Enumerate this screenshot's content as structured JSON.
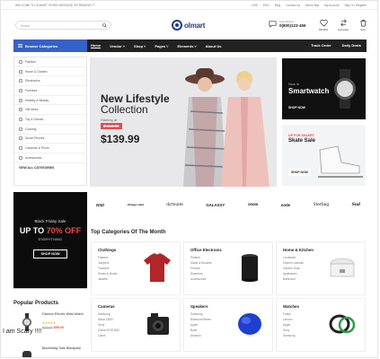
{
  "topbar": {
    "welcome": "WELCOME TO OLMART STORE MESSAGE OR REMOVE IT",
    "currency": "USD",
    "language": "ENG",
    "links": [
      "Blog",
      "Contact Us",
      "Need Help",
      "My Account",
      "Sign In / Register"
    ]
  },
  "header": {
    "search_placeholder": "Search...",
    "logo": "olmart",
    "call_label": "Live Chat or :",
    "phone": "0(800)123-456",
    "wishlist": "Wishlist",
    "compare": "Compare",
    "cart": "Cart"
  },
  "nav": {
    "browse": "Browse Categories",
    "items": [
      {
        "label": "Home",
        "active": true
      },
      {
        "label": "Vendor"
      },
      {
        "label": "Shop"
      },
      {
        "label": "Pages"
      },
      {
        "label": "Elements"
      },
      {
        "label": "About Us"
      }
    ],
    "right": [
      "Track Order",
      "Daily Deals"
    ]
  },
  "sidebar": {
    "items": [
      "Fashion",
      "Home & Garden",
      "Electronics",
      "Furniture",
      "Healthy & Beauty",
      "Gift Ideas",
      "Toy & Games",
      "Cooking",
      "Smart Phones",
      "Cameras & Photo",
      "Accessories",
      "VIEW ALL CATEGORIES"
    ]
  },
  "hero": {
    "title_line1": "New Lifestyle",
    "title_line2": "Collection",
    "starting": "Starting at",
    "old_price": "$ 150.00",
    "price": "$139.99"
  },
  "banner1": {
    "kicker": "Now in",
    "title": "Smartwatch",
    "cta": "SHOP NOW"
  },
  "banner2": {
    "kicker": "UP FOR SKI/ART",
    "title_line1": "Skate Sale",
    "title_line2": "",
    "cta": "SHOP NOW"
  },
  "brands": [
    "NSD",
    "Vintage Label",
    "dirtsuite",
    "GALAXXY",
    "ORIGIN",
    "node",
    "Sterling",
    "Sud"
  ],
  "promo": {
    "line1": "Black Friday Sale",
    "line2_a": "UP TO",
    "line2_b": "70% OFF",
    "line3": "EVERYTHING",
    "cta": "SHOP NOW"
  },
  "top_categories": {
    "title": "Top Categories Of The Month",
    "cards": [
      {
        "name": "Clothings",
        "subs": [
          "Fashion",
          "Jumpers",
          "Trousers",
          "Shoes & Boots",
          "Jackets"
        ]
      },
      {
        "name": "Office Electronic",
        "subs": [
          "Printers",
          "Stand & Buckets",
          "Phones",
          "Scanners",
          "Accessories"
        ]
      },
      {
        "name": "Home & Kitchen",
        "subs": [
          "Cookware",
          "Kitchen Utensils",
          "Garden Tools",
          "Appliances",
          "Bathroom"
        ]
      },
      {
        "name": "Cameras",
        "subs": [
          "Samsung",
          "Nikon D850",
          "Sony",
          "Canon EOS 80D",
          "Lumix"
        ]
      },
      {
        "name": "Speakers",
        "subs": [
          "Samsung",
          "Bluetooth Beam",
          "Apple",
          "Bose",
          "Amazon"
        ]
      },
      {
        "name": "Watches",
        "subs": [
          "Fossil",
          "Lenovo",
          "Apple",
          "Sony",
          "Samsung"
        ]
      }
    ]
  },
  "popular": {
    "title": "Popular Products",
    "items": [
      {
        "name": "Fashion Electric Wrist Watch",
        "stars": "★★★★★",
        "old": "$12.00",
        "price": "$55.00"
      },
      {
        "name": "Blackfriday Sale Blackpack",
        "stars": "★★★★★",
        "old": "",
        "price": ""
      }
    ]
  },
  "overlay": "I am Scary !!!!"
}
